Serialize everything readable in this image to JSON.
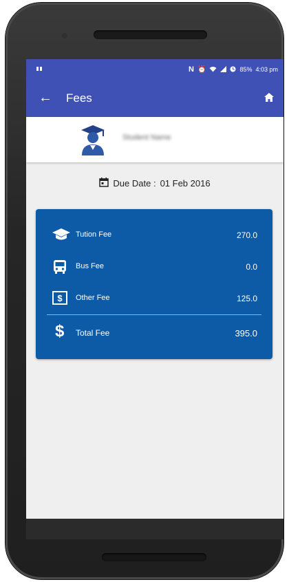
{
  "statusbar": {
    "left_icon": "notification-icon",
    "battery": "85%",
    "time": "4:03 pm"
  },
  "appbar": {
    "title": "Fees",
    "back_icon": "back-arrow-icon",
    "home_icon": "home-icon"
  },
  "profile": {
    "avatar_icon": "graduate-avatar-icon",
    "name": "Student Name"
  },
  "due": {
    "icon": "calendar-icon",
    "label": "Due Date :",
    "date": "01 Feb 2016"
  },
  "fees": {
    "items": [
      {
        "label": "Tution Fee",
        "value": "270.0",
        "icon": "graduation-cap-icon"
      },
      {
        "label": "Bus Fee",
        "value": "0.0",
        "icon": "bus-icon"
      },
      {
        "label": "Other Fee",
        "value": "125.0",
        "icon": "dollar-box-icon"
      }
    ],
    "total": {
      "label": "Total Fee",
      "value": "395.0",
      "icon": "dollar-icon"
    }
  },
  "colors": {
    "primary": "#3f51b5",
    "fee_card": "#0d5aa7",
    "background": "#efefef"
  }
}
